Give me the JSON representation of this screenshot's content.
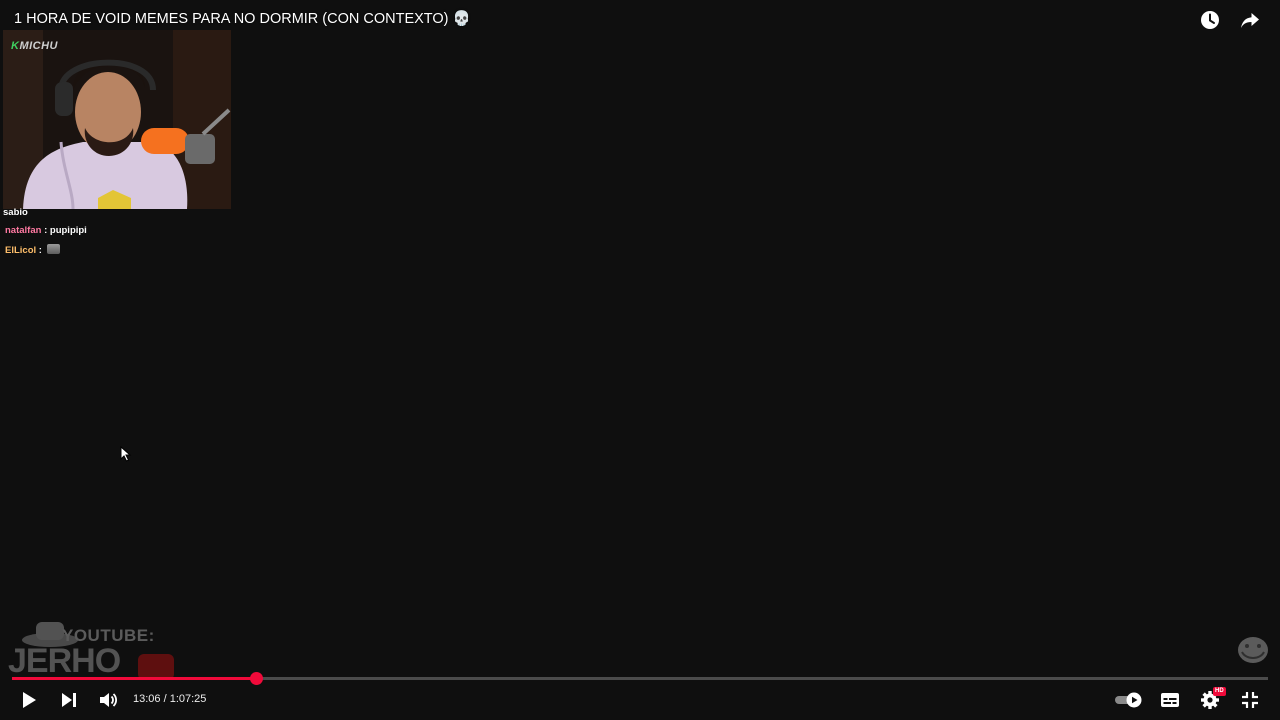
{
  "video": {
    "title": "1 HORA DE VOID MEMES PARA NO DORMIR (CON CONTEXTO) 💀"
  },
  "overlay": {
    "webcam_logo_k": "K",
    "webcam_logo_text": "MICHU",
    "streamer_name": "sabio",
    "chat": [
      {
        "user": "natalfan",
        "separator": " : ",
        "message": "pupipipi"
      },
      {
        "user": "ElLicol",
        "separator": " : ",
        "message": ""
      }
    ],
    "watermark_channel_label": "YOUTUBE:",
    "watermark_channel_name": "JERHO"
  },
  "player": {
    "current_time": "13:06",
    "duration": "1:07:25",
    "time_separator": " / ",
    "progress_fraction": 0.1943,
    "accent_color": "#f00a3a",
    "quality_badge": "HD"
  },
  "icons": {
    "watch_later": "clock-icon",
    "share": "share-arrow-icon",
    "play": "play-icon",
    "next": "next-icon",
    "volume": "volume-icon",
    "autoplay": "autoplay-toggle-icon",
    "captions": "captions-icon",
    "settings": "gear-icon",
    "exit_fullscreen": "exit-fullscreen-icon"
  }
}
